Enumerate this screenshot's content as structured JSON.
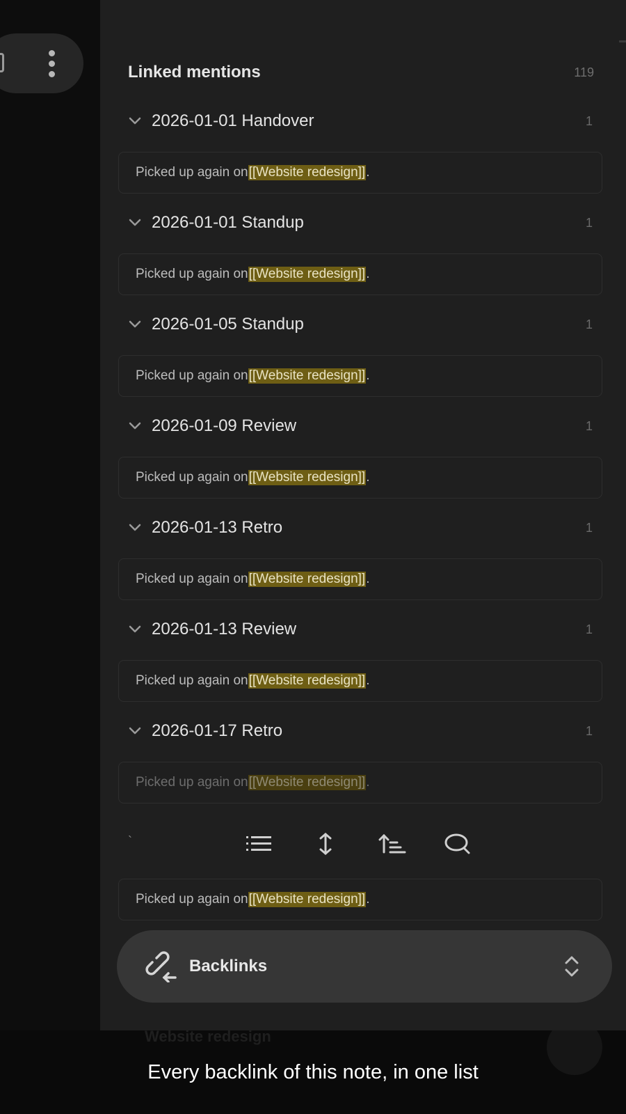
{
  "linked_mentions": {
    "title": "Linked mentions",
    "count": "119"
  },
  "groups": [
    {
      "title": "2026-01-01 Handover",
      "count": "1",
      "snippet_prefix": "Picked up again on ",
      "snippet_link": "[[Website redesign]]",
      "snippet_suffix": "."
    },
    {
      "title": "2026-01-01 Standup",
      "count": "1",
      "snippet_prefix": "Picked up again on ",
      "snippet_link": "[[Website redesign]]",
      "snippet_suffix": "."
    },
    {
      "title": "2026-01-05 Standup",
      "count": "1",
      "snippet_prefix": "Picked up again on ",
      "snippet_link": "[[Website redesign]]",
      "snippet_suffix": "."
    },
    {
      "title": "2026-01-09 Review",
      "count": "1",
      "snippet_prefix": "Picked up again on ",
      "snippet_link": "[[Website redesign]]",
      "snippet_suffix": "."
    },
    {
      "title": "2026-01-13 Retro",
      "count": "1",
      "snippet_prefix": "Picked up again on ",
      "snippet_link": "[[Website redesign]]",
      "snippet_suffix": "."
    },
    {
      "title": "2026-01-13 Review",
      "count": "1",
      "snippet_prefix": "Picked up again on ",
      "snippet_link": "[[Website redesign]]",
      "snippet_suffix": "."
    },
    {
      "title": "2026-01-17 Retro",
      "count": "1",
      "snippet_prefix": "Picked up again on ",
      "snippet_link": "[[Website redesign]]",
      "snippet_suffix": "."
    }
  ],
  "extra_snippet": {
    "prefix": "Picked up again on ",
    "link": "[[Website redesign]]",
    "suffix": "."
  },
  "toolbar": {
    "tick": "`",
    "icons": [
      "list-icon",
      "expand-vertical-icon",
      "sort-icon",
      "search-icon"
    ]
  },
  "backlinks_bar": {
    "label": "Backlinks",
    "icon": "link-icon",
    "toggle_icon": "chevron-updown-icon"
  },
  "ghost": {
    "title": "Website redesign"
  },
  "caption": "Every backlink of this note, in one list",
  "colors": {
    "highlight": "#6e5e14",
    "panel": "#1f1f1f",
    "bar": "#363636"
  }
}
